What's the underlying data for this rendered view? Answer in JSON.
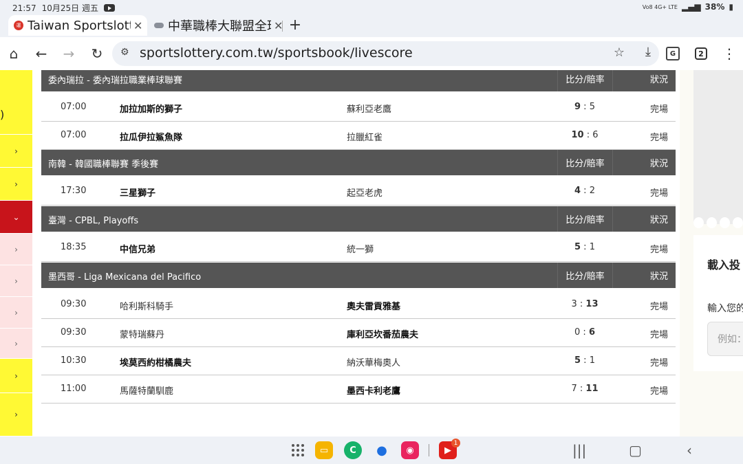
{
  "status_bar": {
    "time": "21:57",
    "date": "10月25日 週五",
    "battery": "38%",
    "network": "Vo8 4G+ LTE"
  },
  "tabs": [
    {
      "title": "Taiwan Sportslottery",
      "favicon_text": "運"
    },
    {
      "title": "中華職棒大聯盟全球資訊網"
    }
  ],
  "toolbar": {
    "url": "sportslottery.com.tw/sportsbook/livescore",
    "tab_count": "2",
    "translate_label": "G"
  },
  "sidebar": {
    "paren_text": ")",
    "chevron_right": "›",
    "chevron_down": "⌄"
  },
  "colors": {
    "league_header_bg": "#555555",
    "sidebar_yellow": "#fff934",
    "sidebar_red": "#c8141b",
    "sidebar_pink": "#fde2e2"
  },
  "leagues": [
    {
      "name": "委內瑞拉 - 委內瑞拉職業棒球聯賽",
      "score_header": "比分/賠率",
      "status_header": "狀況",
      "matches": [
        {
          "time": "07:00",
          "home": "加拉加斯的獅子",
          "away": "蘇利亞老鷹",
          "home_score": "9",
          "away_score": "5",
          "status": "完場"
        },
        {
          "time": "07:00",
          "home": "拉瓜伊拉鯊魚隊",
          "away": "拉臘紅雀",
          "home_score": "10",
          "away_score": "6",
          "status": "完場"
        }
      ]
    },
    {
      "name": "南韓 - 韓國職棒聯賽 季後賽",
      "score_header": "比分/賠率",
      "status_header": "狀況",
      "matches": [
        {
          "time": "17:30",
          "home": "三星獅子",
          "away": "起亞老虎",
          "home_score": "4",
          "away_score": "2",
          "status": "完場"
        }
      ]
    },
    {
      "name": "臺灣 - CPBL, Playoffs",
      "score_header": "比分/賠率",
      "status_header": "狀況",
      "matches": [
        {
          "time": "18:35",
          "home": "中信兄弟",
          "away": "統一獅",
          "home_score": "5",
          "away_score": "1",
          "status": "完場"
        }
      ]
    },
    {
      "name": "墨西哥 - Liga Mexicana del Pacifico",
      "score_header": "比分/賠率",
      "status_header": "狀況",
      "matches": [
        {
          "time": "09:30",
          "home": "哈利斯科騎手",
          "away": "奧夫雷貢雅基",
          "home_score": "3",
          "away_score": "13",
          "status": "完場"
        },
        {
          "time": "09:30",
          "home": "蒙特瑞蘇丹",
          "away": "庫利亞坎番茄農夫",
          "home_score": "0",
          "away_score": "6",
          "status": "完場"
        },
        {
          "time": "10:30",
          "home": "埃莫西約柑橘農夫",
          "away": "納沃華梅奧人",
          "home_score": "5",
          "away_score": "1",
          "status": "完場"
        },
        {
          "time": "11:00",
          "home": "馬薩特蘭馴鹿",
          "away": "墨西卡利老鷹",
          "home_score": "7",
          "away_score": "11",
          "status": "完場"
        }
      ]
    }
  ],
  "right_panel": {
    "title": "載入投",
    "label": "輸入您的",
    "input_placeholder": "例如："
  },
  "nav": {
    "youtube_badge": "1"
  }
}
